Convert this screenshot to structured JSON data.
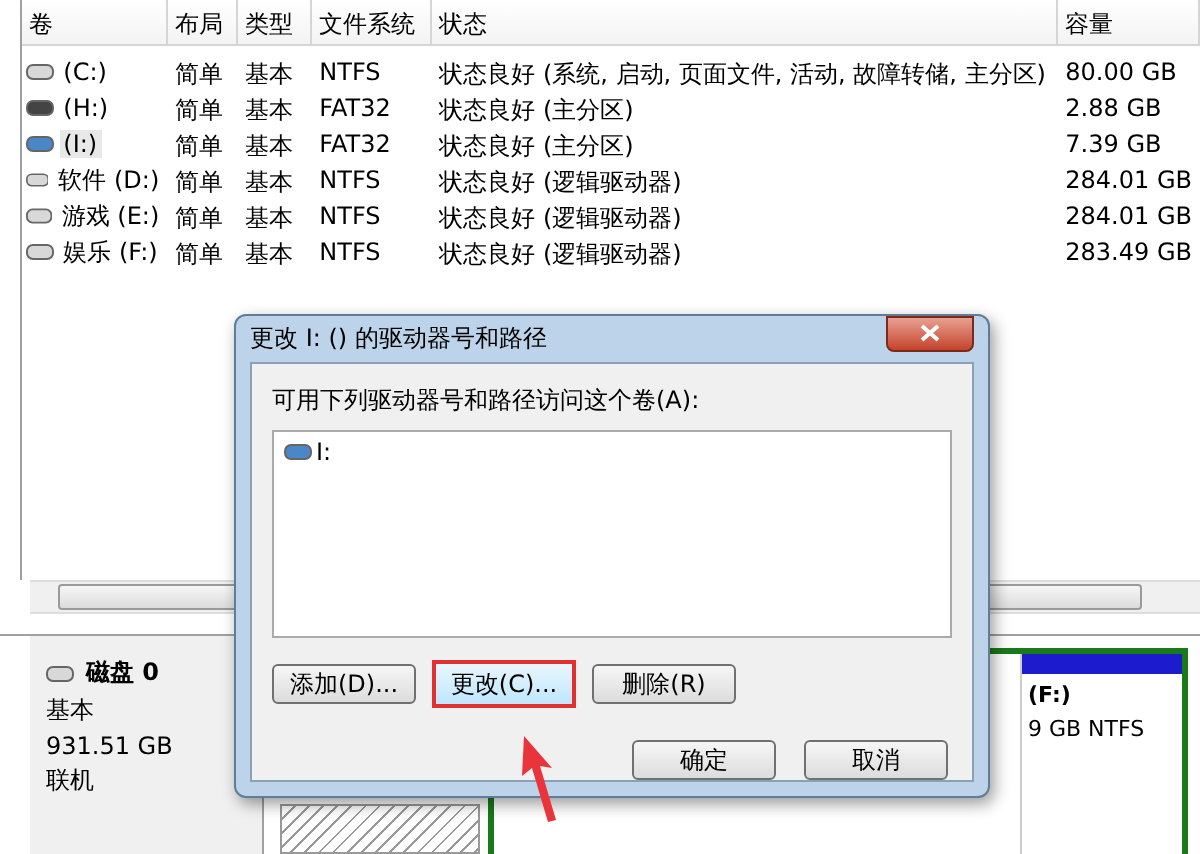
{
  "table": {
    "columns": [
      "卷",
      "布局",
      "类型",
      "文件系统",
      "状态",
      "容量"
    ],
    "rows": [
      {
        "kind": "disk",
        "volume": "(C:)",
        "layout": "简单",
        "type": "基本",
        "fs": "NTFS",
        "status": "状态良好 (系统, 启动, 页面文件, 活动, 故障转储, 主分区)",
        "capacity": "80.00 GB",
        "selected": false
      },
      {
        "kind": "usb",
        "volume": "(H:)",
        "layout": "简单",
        "type": "基本",
        "fs": "FAT32",
        "status": "状态良好 (主分区)",
        "capacity": "2.88 GB",
        "selected": false
      },
      {
        "kind": "removable",
        "volume": "(I:)",
        "layout": "简单",
        "type": "基本",
        "fs": "FAT32",
        "status": "状态良好 (主分区)",
        "capacity": "7.39 GB",
        "selected": true
      },
      {
        "kind": "disk",
        "volume": "软件 (D:)",
        "layout": "简单",
        "type": "基本",
        "fs": "NTFS",
        "status": "状态良好 (逻辑驱动器)",
        "capacity": "284.01 GB",
        "selected": false
      },
      {
        "kind": "disk",
        "volume": "游戏 (E:)",
        "layout": "简单",
        "type": "基本",
        "fs": "NTFS",
        "status": "状态良好 (逻辑驱动器)",
        "capacity": "284.01 GB",
        "selected": false
      },
      {
        "kind": "disk",
        "volume": "娱乐 (F:)",
        "layout": "简单",
        "type": "基本",
        "fs": "NTFS",
        "status": "状态良好 (逻辑驱动器)",
        "capacity": "283.49 GB",
        "selected": false
      }
    ]
  },
  "disk": {
    "name": "磁盘 0",
    "type": "基本",
    "size": "931.51 GB",
    "status": "联机",
    "partition": {
      "name": "(F:)",
      "detail": "9 GB NTFS"
    }
  },
  "dialog": {
    "title": "更改 I: () 的驱动器号和路径",
    "prompt": "可用下列驱动器号和路径访问这个卷(A):",
    "paths": [
      "I:"
    ],
    "buttons": [
      {
        "label": "添加(D)...",
        "highlighted": false
      },
      {
        "label": "更改(C)...",
        "highlighted": true
      },
      {
        "label": "删除(R)",
        "highlighted": false
      }
    ],
    "footer": [
      "确定",
      "取消"
    ]
  }
}
